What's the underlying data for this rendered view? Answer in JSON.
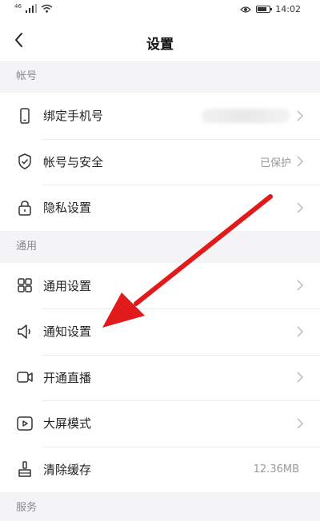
{
  "status_bar": {
    "time": "14:02",
    "signal_label": "46"
  },
  "nav": {
    "title": "设置"
  },
  "sections": {
    "account": {
      "header": "帐号",
      "rows": [
        {
          "label": "绑定手机号",
          "value": ""
        },
        {
          "label": "帐号与安全",
          "value": "已保护"
        },
        {
          "label": "隐私设置",
          "value": ""
        }
      ]
    },
    "general": {
      "header": "通用",
      "rows": [
        {
          "label": "通用设置",
          "value": ""
        },
        {
          "label": "通知设置",
          "value": ""
        },
        {
          "label": "开通直播",
          "value": ""
        },
        {
          "label": "大屏模式",
          "value": ""
        },
        {
          "label": "清除缓存",
          "value": "12.36MB"
        }
      ]
    },
    "service": {
      "header": "服务"
    }
  },
  "icons": {
    "phone": "phone-icon",
    "shield": "shield-icon",
    "lock": "lock-icon",
    "grid": "grid-icon",
    "speaker": "speaker-icon",
    "video": "video-camera-icon",
    "play": "play-icon",
    "broom": "broom-icon",
    "chevron": "chevron-right-icon"
  },
  "colors": {
    "annotation_arrow": "#e11b1b"
  }
}
